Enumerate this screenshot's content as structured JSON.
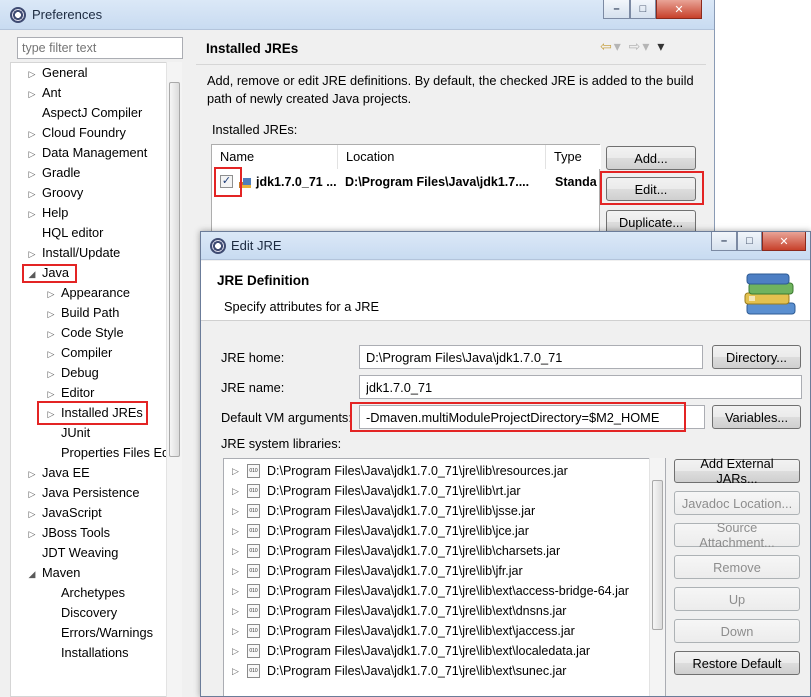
{
  "prefs": {
    "title": "Preferences",
    "filter_placeholder": "type filter text",
    "tree": [
      {
        "label": "General",
        "arrow": "▷"
      },
      {
        "label": "Ant",
        "arrow": "▷"
      },
      {
        "label": "AspectJ Compiler",
        "arrow": ""
      },
      {
        "label": "Cloud Foundry",
        "arrow": "▷"
      },
      {
        "label": "Data Management",
        "arrow": "▷"
      },
      {
        "label": "Gradle",
        "arrow": "▷"
      },
      {
        "label": "Groovy",
        "arrow": "▷"
      },
      {
        "label": "Help",
        "arrow": "▷"
      },
      {
        "label": "HQL editor",
        "arrow": ""
      },
      {
        "label": "Install/Update",
        "arrow": "▷"
      },
      {
        "label": "Java",
        "arrow": "◢"
      },
      {
        "label": "Appearance",
        "arrow": "▷"
      },
      {
        "label": "Build Path",
        "arrow": "▷"
      },
      {
        "label": "Code Style",
        "arrow": "▷"
      },
      {
        "label": "Compiler",
        "arrow": "▷"
      },
      {
        "label": "Debug",
        "arrow": "▷"
      },
      {
        "label": "Editor",
        "arrow": "▷"
      },
      {
        "label": "Installed JREs",
        "arrow": "▷"
      },
      {
        "label": "JUnit",
        "arrow": ""
      },
      {
        "label": "Properties Files Ed",
        "arrow": ""
      },
      {
        "label": "Java EE",
        "arrow": "▷"
      },
      {
        "label": "Java Persistence",
        "arrow": "▷"
      },
      {
        "label": "JavaScript",
        "arrow": "▷"
      },
      {
        "label": "JBoss Tools",
        "arrow": "▷"
      },
      {
        "label": "JDT Weaving",
        "arrow": ""
      },
      {
        "label": "Maven",
        "arrow": "◢"
      },
      {
        "label": "Archetypes",
        "arrow": ""
      },
      {
        "label": "Discovery",
        "arrow": ""
      },
      {
        "label": "Errors/Warnings",
        "arrow": ""
      },
      {
        "label": "Installations",
        "arrow": ""
      }
    ],
    "page_title": "Installed JREs",
    "description": "Add, remove or edit JRE definitions. By default, the checked JRE is added to the build path of newly created Java projects.",
    "installed_label": "Installed JREs:",
    "columns": [
      "Name",
      "Location",
      "Type"
    ],
    "row": {
      "checked": "✓",
      "name": "jdk1.7.0_71 ...",
      "location": "D:\\Program Files\\Java\\jdk1.7....",
      "type": "Standa"
    },
    "buttons": {
      "add": "Add...",
      "edit": "Edit...",
      "duplicate": "Duplicate..."
    }
  },
  "dialog": {
    "title": "Edit JRE",
    "header_title": "JRE Definition",
    "header_sub": "Specify attributes for a JRE",
    "jre_home_label": "JRE home:",
    "jre_home_value": "D:\\Program Files\\Java\\jdk1.7.0_71",
    "directory_button": "Directory...",
    "jre_name_label": "JRE name:",
    "jre_name_value": "jdk1.7.0_71",
    "vm_args_label": "Default VM arguments:",
    "vm_args_value": "-Dmaven.multiModuleProjectDirectory=$M2_HOME",
    "variables_button": "Variables...",
    "libs_label": "JRE system libraries:",
    "libs": [
      "D:\\Program Files\\Java\\jdk1.7.0_71\\jre\\lib\\resources.jar",
      "D:\\Program Files\\Java\\jdk1.7.0_71\\jre\\lib\\rt.jar",
      "D:\\Program Files\\Java\\jdk1.7.0_71\\jre\\lib\\jsse.jar",
      "D:\\Program Files\\Java\\jdk1.7.0_71\\jre\\lib\\jce.jar",
      "D:\\Program Files\\Java\\jdk1.7.0_71\\jre\\lib\\charsets.jar",
      "D:\\Program Files\\Java\\jdk1.7.0_71\\jre\\lib\\jfr.jar",
      "D:\\Program Files\\Java\\jdk1.7.0_71\\jre\\lib\\ext\\access-bridge-64.jar",
      "D:\\Program Files\\Java\\jdk1.7.0_71\\jre\\lib\\ext\\dnsns.jar",
      "D:\\Program Files\\Java\\jdk1.7.0_71\\jre\\lib\\ext\\jaccess.jar",
      "D:\\Program Files\\Java\\jdk1.7.0_71\\jre\\lib\\ext\\localedata.jar",
      "D:\\Program Files\\Java\\jdk1.7.0_71\\jre\\lib\\ext\\sunec.jar"
    ],
    "jar_icon_text": "010",
    "lib_buttons": {
      "add_external": "Add External JARs...",
      "javadoc": "Javadoc Location...",
      "source": "Source Attachment...",
      "remove": "Remove",
      "up": "Up",
      "down": "Down",
      "restore": "Restore Default"
    }
  },
  "colors": {
    "highlight": "#e32424",
    "title_bar": "#c8dbf1"
  }
}
